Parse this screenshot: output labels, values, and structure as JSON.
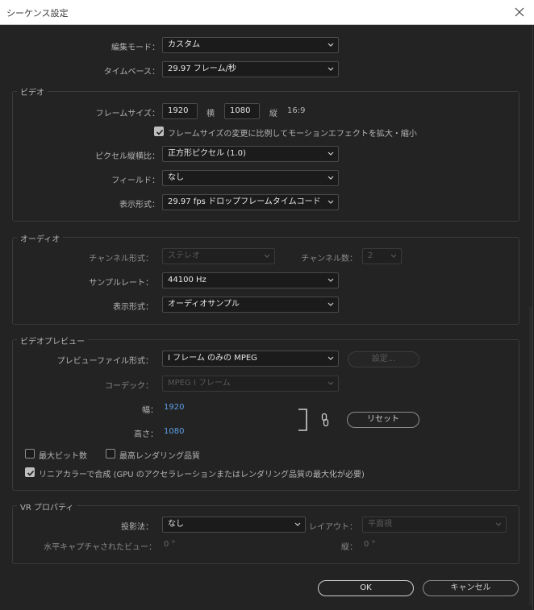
{
  "window": {
    "title": "シーケンス設定"
  },
  "general": {
    "edit_mode_label": "編集モード：",
    "edit_mode_value": "カスタム",
    "timebase_label": "タイムベース：",
    "timebase_value": "29.97  フレーム/秒"
  },
  "video": {
    "group_title": "ビデオ",
    "frame_size_label": "フレームサイズ：",
    "width_value": "1920",
    "width_unit": "横",
    "height_value": "1080",
    "height_unit": "縦",
    "aspect_text": "16:9",
    "scale_motion_label": "フレームサイズの変更に比例してモーションエフェクトを拡大・縮小",
    "scale_motion_checked": true,
    "pixel_aspect_label": "ピクセル縦横比：",
    "pixel_aspect_value": "正方形ピクセル (1.0)",
    "fields_label": "フィールド：",
    "fields_value": "なし",
    "display_format_label": "表示形式：",
    "display_format_value": "29.97  fps ドロップフレームタイムコード"
  },
  "audio": {
    "group_title": "オーディオ",
    "channel_format_label": "チャンネル形式：",
    "channel_format_value": "ステレオ",
    "channel_count_label": "チャンネル数：",
    "channel_count_value": "2",
    "sample_rate_label": "サンプルレート：",
    "sample_rate_value": "44100 Hz",
    "display_format_label": "表示形式：",
    "display_format_value": "オーディオサンプル"
  },
  "preview": {
    "group_title": "ビデオプレビュー",
    "file_format_label": "プレビューファイル形式：",
    "file_format_value": "I フレーム のみの  MPEG",
    "settings_button": "設定...",
    "codec_label": "コーデック：",
    "codec_value": "MPEG I フレーム",
    "width_label": "幅：",
    "width_value": "1920",
    "height_label": "高さ：",
    "height_value": "1080",
    "reset_button": "リセット",
    "max_bit_depth_label": "最大ビット数",
    "max_bit_depth_checked": false,
    "max_render_quality_label": "最高レンダリング品質",
    "max_render_quality_checked": false,
    "linear_color_label": "リニアカラーで合成 (GPU のアクセラレーションまたはレンダリング品質の最大化が必要)",
    "linear_color_checked": true
  },
  "vr": {
    "group_title": "VR プロパティ",
    "projection_label": "投影法：",
    "projection_value": "なし",
    "layout_label": "レイアウト：",
    "layout_value": "平面視",
    "h_capture_label": "水平キャプチャされたビュー：",
    "h_capture_value": "0 °",
    "v_label": "縦：",
    "v_value": "0 °"
  },
  "footer": {
    "ok_button": "OK",
    "cancel_button": "キャンセル"
  },
  "colors": {
    "background": "#232323",
    "accent_blue": "#5c9ee6",
    "titlebar": "#ffffff"
  }
}
